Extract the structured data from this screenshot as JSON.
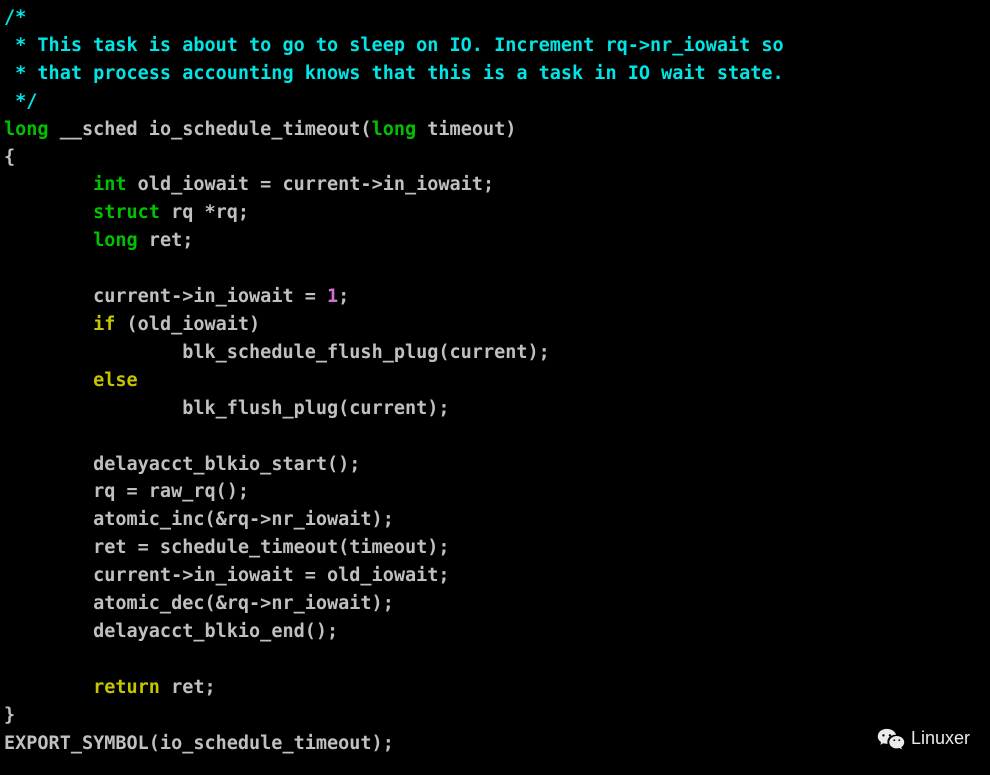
{
  "code": {
    "c1": "/*",
    "c2": " * This task is about to go to sleep on IO. Increment rq->nr_iowait so",
    "c3": " * that process accounting knows that this is a task in IO wait state.",
    "c4": " */",
    "l5_kw1": "long",
    "l5_txt1": " __sched io_schedule_timeout(",
    "l5_kw2": "long",
    "l5_txt2": " timeout)",
    "l6": "{",
    "l7_kw": "int",
    "l7_txt": " old_iowait = current->in_iowait;",
    "l8_kw": "struct",
    "l8_txt": " rq *rq;",
    "l9_kw": "long",
    "l9_txt": " ret;",
    "l11_txt1": "current->in_iowait = ",
    "l11_num": "1",
    "l11_txt2": ";",
    "l12_kw": "if",
    "l12_txt": " (old_iowait)",
    "l13": "blk_schedule_flush_plug(current);",
    "l14_kw": "else",
    "l15": "blk_flush_plug(current);",
    "l17": "delayacct_blkio_start();",
    "l18": "rq = raw_rq();",
    "l19": "atomic_inc(&rq->nr_iowait);",
    "l20": "ret = schedule_timeout(timeout);",
    "l21": "current->in_iowait = old_iowait;",
    "l22": "atomic_dec(&rq->nr_iowait);",
    "l23": "delayacct_blkio_end();",
    "l25_kw": "return",
    "l25_txt": " ret;",
    "l26": "}",
    "l27": "EXPORT_SYMBOL(io_schedule_timeout);"
  },
  "watermark": {
    "label": "Linuxer"
  }
}
